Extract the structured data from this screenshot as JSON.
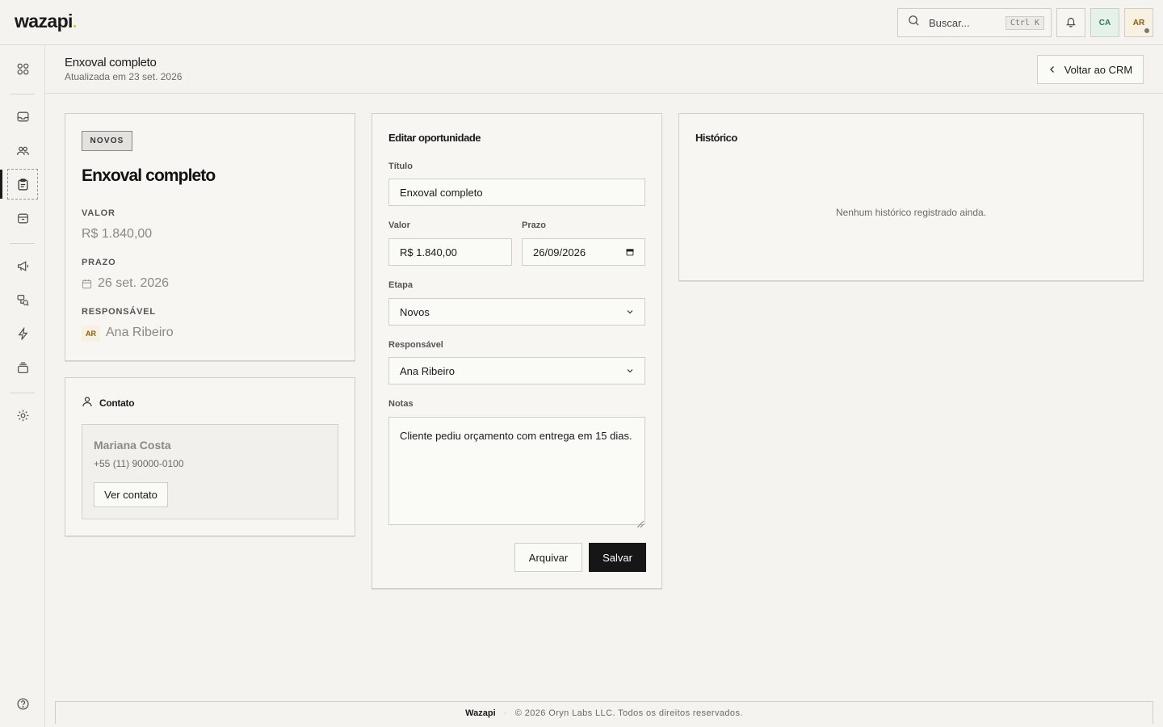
{
  "app": {
    "logo": "wazapi"
  },
  "topbar": {
    "search": {
      "placeholder": "Buscar...",
      "shortcut": "Ctrl K"
    },
    "org_initials": "CA",
    "user_initials": "AR"
  },
  "sidebar": {
    "items": [
      "grid-icon",
      "inbox-icon",
      "users-icon",
      "clipboard-icon",
      "archive-icon",
      "megaphone-icon",
      "flow-icon",
      "lightning-icon",
      "stack-icon",
      "gear-icon",
      "help-icon"
    ],
    "active": "clipboard-icon"
  },
  "header": {
    "title": "Enxoval completo",
    "subtitle": "Atualizada em 23 set. 2026",
    "back_label": "Voltar ao CRM"
  },
  "summary": {
    "stage_badge": "NOVOS",
    "title": "Enxoval completo",
    "value_label": "VALOR",
    "value": "R$ 1.840,00",
    "deadline_label": "PRAZO",
    "deadline": "26 set. 2026",
    "owner_label": "RESPONSÁVEL",
    "owner_initials": "AR",
    "owner": "Ana Ribeiro"
  },
  "contact": {
    "heading": "Contato",
    "name": "Mariana Costa",
    "phone": "+55 (11) 90000-0100",
    "button": "Ver contato"
  },
  "edit": {
    "heading": "Editar oportunidade",
    "title_label": "Título",
    "title_value": "Enxoval completo",
    "value_label": "Valor",
    "value_value": "R$ 1.840,00",
    "deadline_label": "Prazo",
    "deadline_value": "26/09/2026",
    "stage_label": "Etapa",
    "stage_value": "Novos",
    "owner_label": "Responsável",
    "owner_value": "Ana Ribeiro",
    "notes_label": "Notas",
    "notes_value": "Cliente pediu orçamento com entrega em 15 dias.",
    "archive_button": "Arquivar",
    "save_button": "Salvar"
  },
  "history": {
    "heading": "Histórico",
    "empty": "Nenhum histórico registrado ainda."
  },
  "footer": {
    "brand": "Wazapi",
    "separator": "·",
    "copyright": "© 2026 Oryn Labs LLC. Todos os direitos reservados."
  },
  "colors": {
    "background": "#f4f3ef",
    "primary_button": "#161616",
    "org_avatar_bg": "#e4f2ea",
    "user_avatar_bg": "#f8f1e2"
  }
}
